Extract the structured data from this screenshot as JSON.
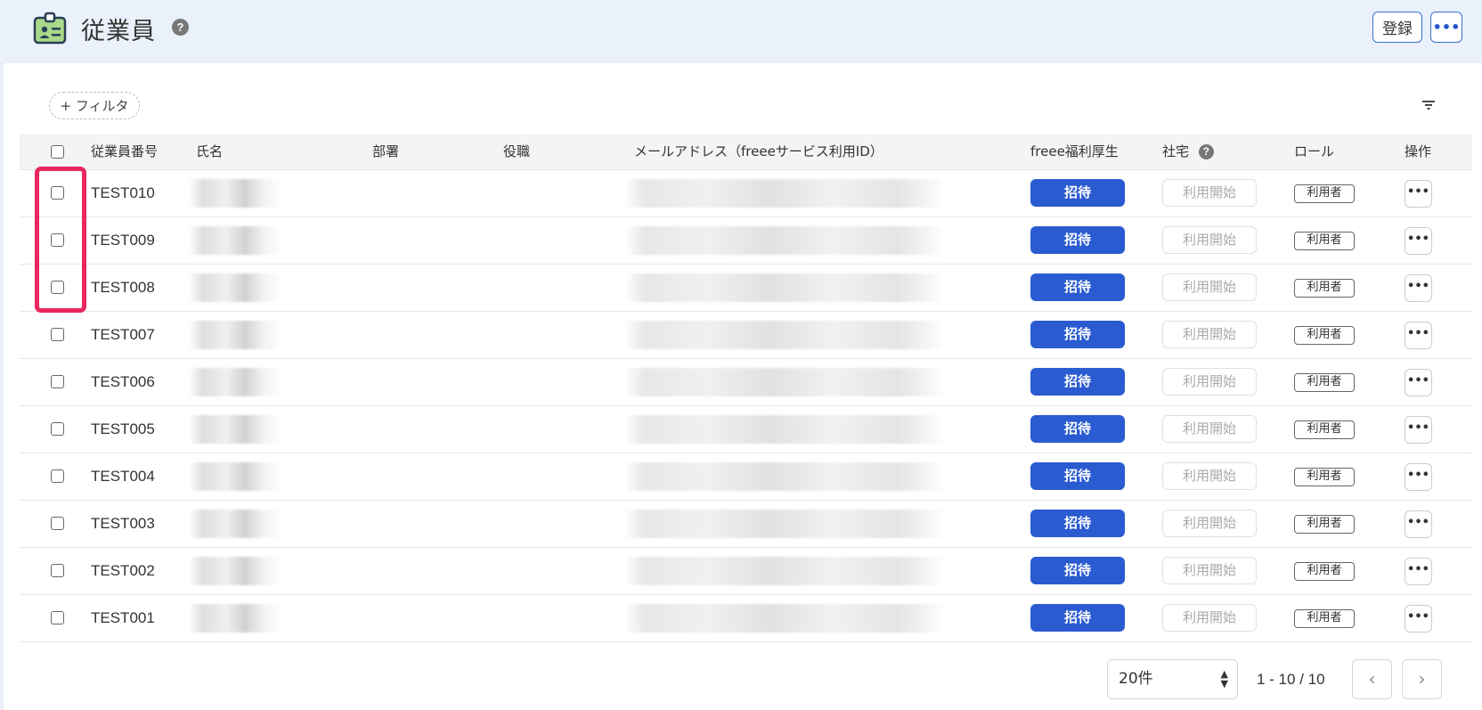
{
  "header": {
    "title": "従業員",
    "help_icon": "?",
    "register_label": "登録",
    "more_label": "•••"
  },
  "toolbar": {
    "filter_label": "+ フィルタ"
  },
  "table": {
    "columns": {
      "employee_number": "従業員番号",
      "name": "氏名",
      "department": "部署",
      "position": "役職",
      "email": "メールアドレス（freeeサービス利用ID）",
      "welfare": "freee福利厚生",
      "housing": "社宅",
      "role": "ロール",
      "actions": "操作"
    },
    "rows": [
      {
        "id": "TEST010",
        "invite": "招待",
        "start": "利用開始",
        "role": "利用者",
        "more": "•••"
      },
      {
        "id": "TEST009",
        "invite": "招待",
        "start": "利用開始",
        "role": "利用者",
        "more": "•••"
      },
      {
        "id": "TEST008",
        "invite": "招待",
        "start": "利用開始",
        "role": "利用者",
        "more": "•••"
      },
      {
        "id": "TEST007",
        "invite": "招待",
        "start": "利用開始",
        "role": "利用者",
        "more": "•••"
      },
      {
        "id": "TEST006",
        "invite": "招待",
        "start": "利用開始",
        "role": "利用者",
        "more": "•••"
      },
      {
        "id": "TEST005",
        "invite": "招待",
        "start": "利用開始",
        "role": "利用者",
        "more": "•••"
      },
      {
        "id": "TEST004",
        "invite": "招待",
        "start": "利用開始",
        "role": "利用者",
        "more": "•••"
      },
      {
        "id": "TEST003",
        "invite": "招待",
        "start": "利用開始",
        "role": "利用者",
        "more": "•••"
      },
      {
        "id": "TEST002",
        "invite": "招待",
        "start": "利用開始",
        "role": "利用者",
        "more": "•••"
      },
      {
        "id": "TEST001",
        "invite": "招待",
        "start": "利用開始",
        "role": "利用者",
        "more": "•••"
      }
    ]
  },
  "pagination": {
    "per_page": "20件",
    "range": "1 - 10 / 10",
    "prev_icon": "‹",
    "next_icon": "›"
  },
  "colors": {
    "header_bg": "#eaf1fb",
    "primary": "#2a5bd0",
    "highlight": "#e8275e"
  }
}
